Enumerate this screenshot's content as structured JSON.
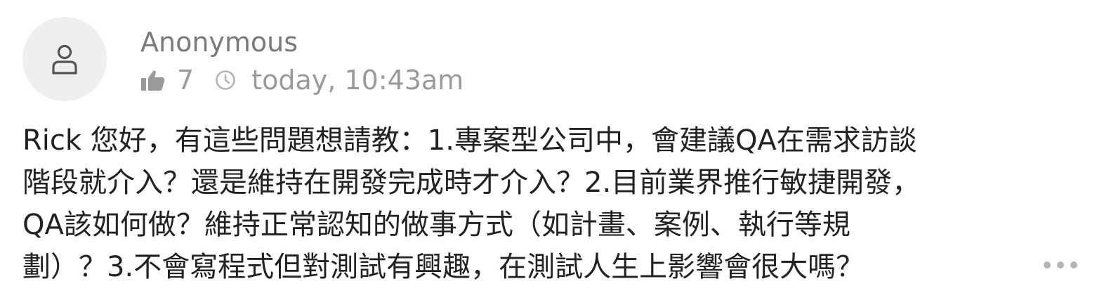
{
  "comment": {
    "author": "Anonymous",
    "likes": "7",
    "timestamp": "today, 10:43am",
    "body_lines": [
      "Rick 您好，有這些問題想請教：1.專案型公司中，會建議QA在需求訪談",
      "階段就介入？還是維持在開發完成時才介入？2.目前業界推行敏捷開發，",
      "QA該如何做？維持正常認知的做事方式（如計畫、案例、執行等規",
      "劃）？3.不會寫程式但對測試有興趣，在測試人生上影響會很大嗎？"
    ]
  },
  "icons": {
    "avatar": "user-icon",
    "likes": "thumbs-up-icon",
    "time": "clock-icon",
    "more": "more-horizontal-icon"
  },
  "colors": {
    "avatar_bg": "#efefef",
    "meta_text": "#9a9a9a",
    "body_text": "#222222"
  }
}
